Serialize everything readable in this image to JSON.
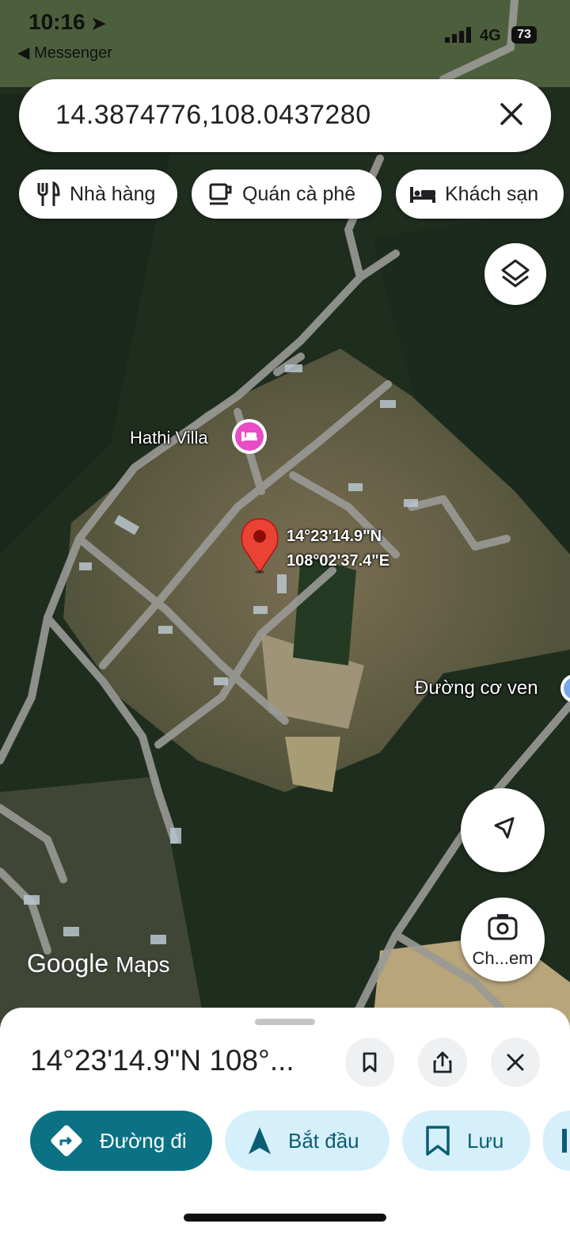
{
  "status_bar": {
    "time": "10:16",
    "back_app": "◀ Messenger",
    "network": "4G",
    "battery": "73"
  },
  "search": {
    "query": "14.3874776,108.0437280"
  },
  "chips": [
    {
      "label": "Nhà hàng",
      "icon": "restaurant-icon"
    },
    {
      "label": "Quán cà phê",
      "icon": "coffee-icon"
    },
    {
      "label": "Khách sạn",
      "icon": "hotel-icon"
    }
  ],
  "map": {
    "labels": {
      "hathi": "Hathi Villa",
      "road": "Đường cơ ven"
    },
    "pin": {
      "lat": "14°23'14.9\"N",
      "lng": "108°02'37.4\"E",
      "color": "#ea4335"
    },
    "hotel_marker_color": "#e84cc7",
    "logo": {
      "google": "Google",
      "maps": "Maps"
    },
    "street_view_label": "Ch...em"
  },
  "sheet": {
    "title": "14°23'14.9\"N 108°...",
    "actions": [
      {
        "label": "Đường đi",
        "icon": "directions-icon",
        "style": "primary"
      },
      {
        "label": "Bắt đầu",
        "icon": "navigation-arrow-icon",
        "style": "secondary"
      },
      {
        "label": "Lưu",
        "icon": "bookmark-icon",
        "style": "secondary"
      }
    ]
  },
  "colors": {
    "primary": "#0b7285",
    "secondary_bg": "#d6f0fb"
  }
}
